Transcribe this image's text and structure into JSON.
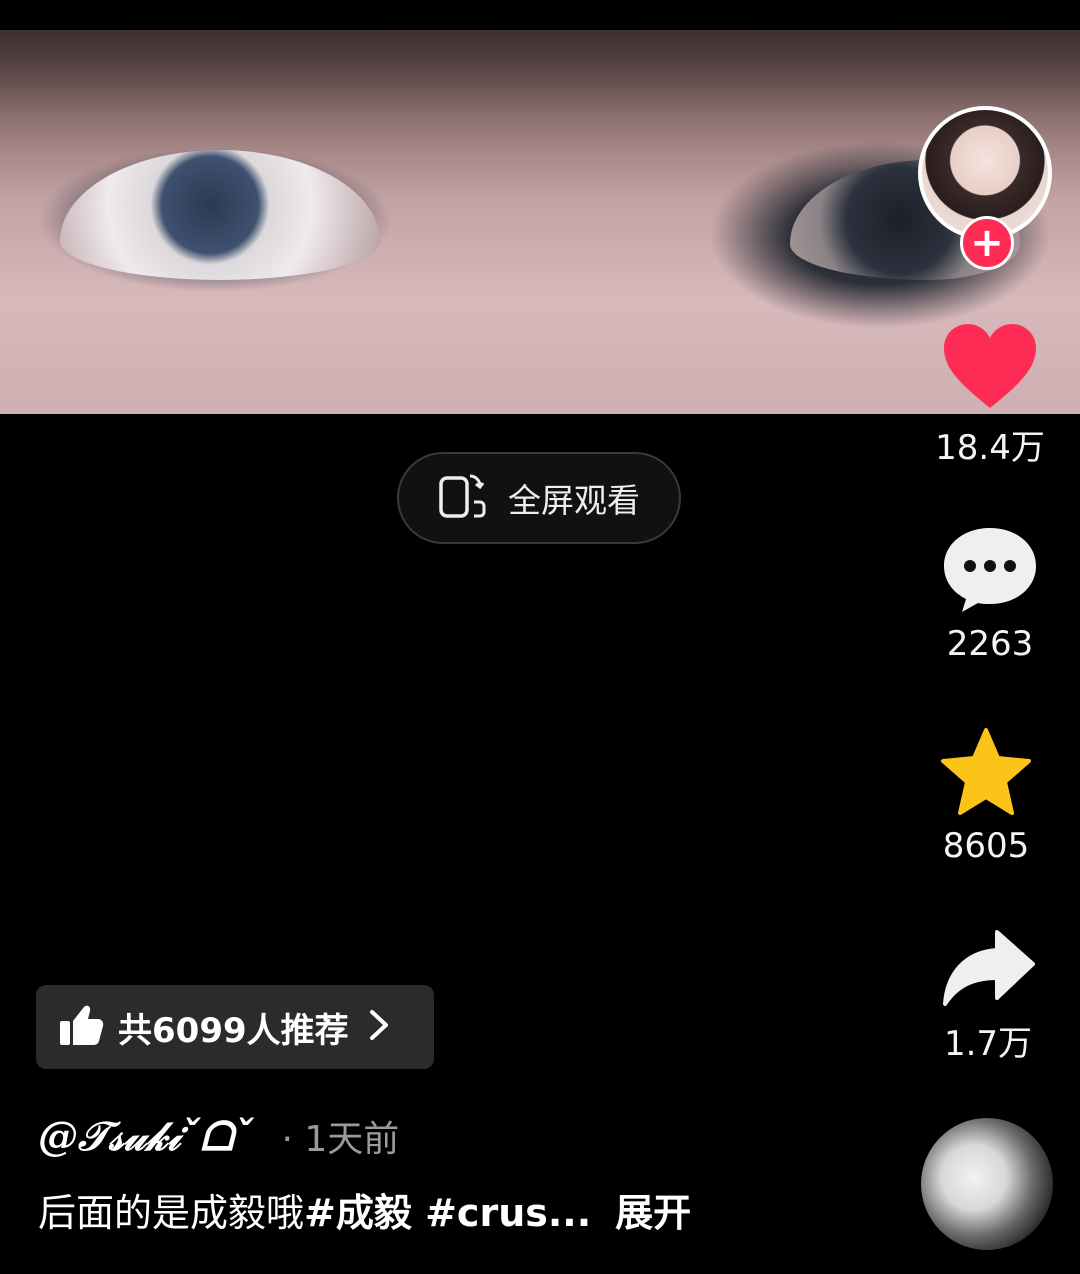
{
  "video": {
    "description_icon": "video-frame-eyes"
  },
  "fullscreen": {
    "label": "全屏观看",
    "icon": "rotate-phone-icon"
  },
  "creator": {
    "follow_icon": "plus-icon"
  },
  "actions": {
    "like_count": "18.4万",
    "comment_count": "2263",
    "favorite_count": "8605",
    "share_count": "1.7万"
  },
  "recommend": {
    "label": "共6099人推荐",
    "icon": "thumbs-up-icon"
  },
  "post": {
    "author": "@𝒯𝓈𝓊𝓀𝒾ˇᗝˇ",
    "time": "· 1天前",
    "caption_text": "后面的是成毅哦",
    "caption_tags": "#成毅 #crus...",
    "expand_label": "展开"
  },
  "colors": {
    "accent": "#fe2c55",
    "star": "#fcc419",
    "background": "#000000"
  }
}
